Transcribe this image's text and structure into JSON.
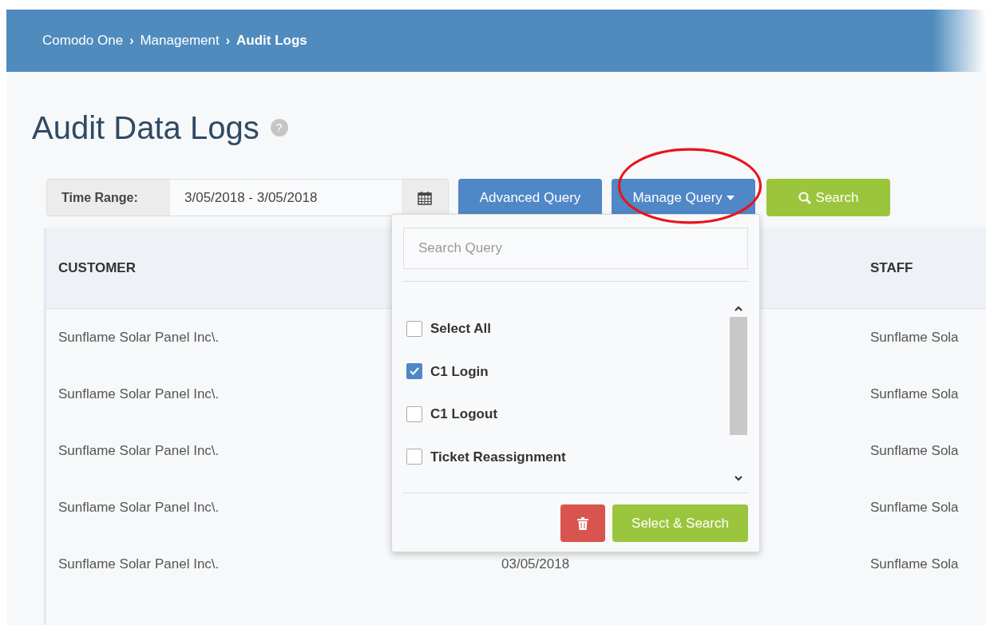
{
  "breadcrumb": [
    {
      "label": "Comodo One",
      "current": false
    },
    {
      "separator_before": "›",
      "label": "Management",
      "current": false
    },
    {
      "separator_before": "›",
      "label": "Audit Logs",
      "current": true
    }
  ],
  "title": "Audit Data Logs",
  "help": "?",
  "toolbar": {
    "time_range_label": "Time Range:",
    "time_range_value": "3/05/2018 - 3/05/2018",
    "advanced_query": "Advanced Query",
    "manage_query": "Manage Query",
    "search": "Search"
  },
  "dropdown": {
    "placeholder": "Search Query",
    "items": [
      {
        "label": "Select All",
        "checked": false
      },
      {
        "label": "C1 Login",
        "checked": true
      },
      {
        "label": "C1 Logout",
        "checked": false
      },
      {
        "label": "Ticket Reassignment",
        "checked": false
      }
    ],
    "select_search": "Select & Search"
  },
  "table": {
    "columns": [
      "CUSTOMER",
      "",
      "STAFF"
    ],
    "rows": [
      [
        "Sunflame Solar Panel Inc\\.",
        "",
        "Sunflame Sola"
      ],
      [
        "Sunflame Solar Panel Inc\\.",
        "",
        "Sunflame Sola"
      ],
      [
        "Sunflame Solar Panel Inc\\.",
        "",
        "Sunflame Sola"
      ],
      [
        "Sunflame Solar Panel Inc\\.",
        "",
        "Sunflame Sola"
      ],
      [
        "Sunflame Solar Panel Inc\\.",
        "03/05/2018",
        "Sunflame Sola"
      ]
    ]
  }
}
